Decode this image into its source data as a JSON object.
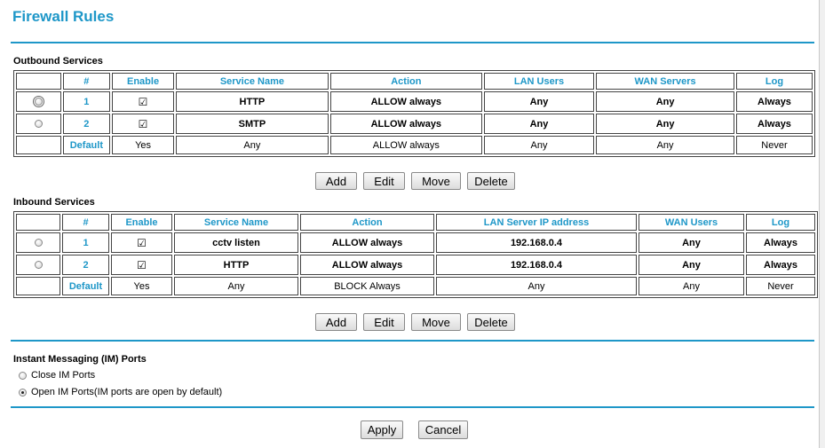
{
  "page": {
    "title": "Firewall Rules"
  },
  "outbound": {
    "title": "Outbound Services",
    "columns": [
      "#",
      "Enable",
      "Service Name",
      "Action",
      "LAN Users",
      "WAN Servers",
      "Log"
    ],
    "rows": [
      {
        "num": "1",
        "enabled": true,
        "service": "HTTP",
        "action": "ALLOW always",
        "lan": "Any",
        "wan": "Any",
        "log": "Always"
      },
      {
        "num": "2",
        "enabled": true,
        "service": "SMTP",
        "action": "ALLOW always",
        "lan": "Any",
        "wan": "Any",
        "log": "Always"
      }
    ],
    "default": {
      "label": "Default",
      "enable": "Yes",
      "service": "Any",
      "action": "ALLOW always",
      "lan": "Any",
      "wan": "Any",
      "log": "Never"
    }
  },
  "inbound": {
    "title": "Inbound Services",
    "columns": [
      "#",
      "Enable",
      "Service Name",
      "Action",
      "LAN Server IP address",
      "WAN Users",
      "Log"
    ],
    "rows": [
      {
        "num": "1",
        "enabled": true,
        "service": "cctv listen",
        "action": "ALLOW always",
        "ip": "192.168.0.4",
        "wan": "Any",
        "log": "Always"
      },
      {
        "num": "2",
        "enabled": true,
        "service": "HTTP",
        "action": "ALLOW always",
        "ip": "192.168.0.4",
        "wan": "Any",
        "log": "Always"
      }
    ],
    "default": {
      "label": "Default",
      "enable": "Yes",
      "service": "Any",
      "action": "BLOCK Always",
      "ip": "Any",
      "wan": "Any",
      "log": "Never"
    }
  },
  "buttons": {
    "add": "Add",
    "edit": "Edit",
    "move": "Move",
    "delete": "Delete",
    "apply": "Apply",
    "cancel": "Cancel"
  },
  "im": {
    "title": "Instant Messaging (IM) Ports",
    "options": [
      {
        "label": "Close IM Ports",
        "selected": false
      },
      {
        "label": "Open IM Ports(IM ports are open by default)",
        "selected": true
      }
    ]
  },
  "checkmark": "☑",
  "colors": {
    "accent": "#1e97c8"
  }
}
